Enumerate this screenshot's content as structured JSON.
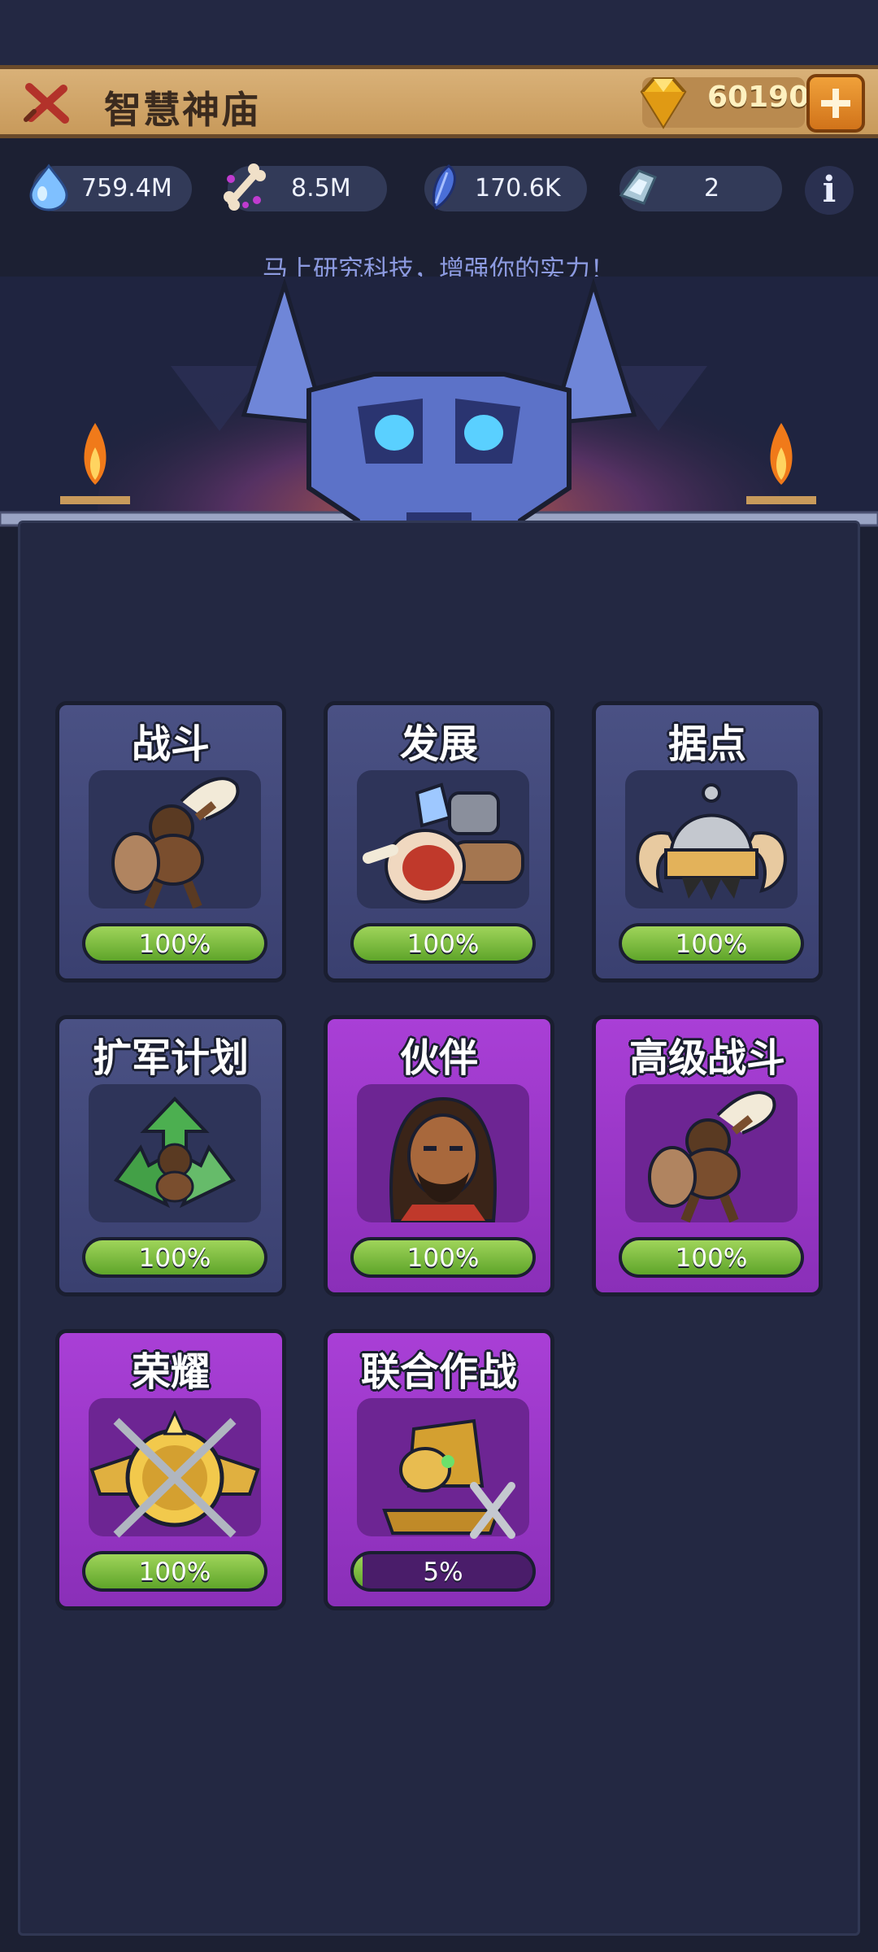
{
  "header": {
    "title": "智慧神庙",
    "gems": "60190"
  },
  "resources": [
    {
      "icon": "water-drop-icon",
      "value": "759.4M"
    },
    {
      "icon": "bone-icon",
      "value": "8.5M"
    },
    {
      "icon": "feather-token-icon",
      "value": "170.6K"
    },
    {
      "icon": "crystal-shard-icon",
      "value": "2"
    }
  ],
  "subtitle": "马上研究科技，增强你的实力！",
  "colors": {
    "blue_card": "#4a5184",
    "purple_card": "#a93fd6",
    "progress_green": "#7fc03f",
    "title_bar": "#d9b178"
  },
  "tech_cards": [
    {
      "label": "战斗",
      "progress_text": "100%",
      "progress": 1.0,
      "style": "blue",
      "icon": "club-warrior-icon"
    },
    {
      "label": "发展",
      "progress_text": "100%",
      "progress": 1.0,
      "style": "blue",
      "icon": "resources-pile-icon"
    },
    {
      "label": "据点",
      "progress_text": "100%",
      "progress": 1.0,
      "style": "blue",
      "icon": "horned-helmet-icon"
    },
    {
      "label": "扩军计划",
      "progress_text": "100%",
      "progress": 1.0,
      "style": "blue",
      "icon": "recycle-warrior-icon"
    },
    {
      "label": "伙伴",
      "progress_text": "100%",
      "progress": 1.0,
      "style": "purple",
      "icon": "bearded-hero-icon"
    },
    {
      "label": "高级战斗",
      "progress_text": "100%",
      "progress": 1.0,
      "style": "purple",
      "icon": "club-warrior-icon"
    },
    {
      "label": "荣耀",
      "progress_text": "100%",
      "progress": 1.0,
      "style": "purple",
      "icon": "winged-emblem-icon"
    },
    {
      "label": "联合作战",
      "progress_text": "5%",
      "progress": 0.05,
      "style": "purple",
      "icon": "golden-totem-icon"
    }
  ]
}
